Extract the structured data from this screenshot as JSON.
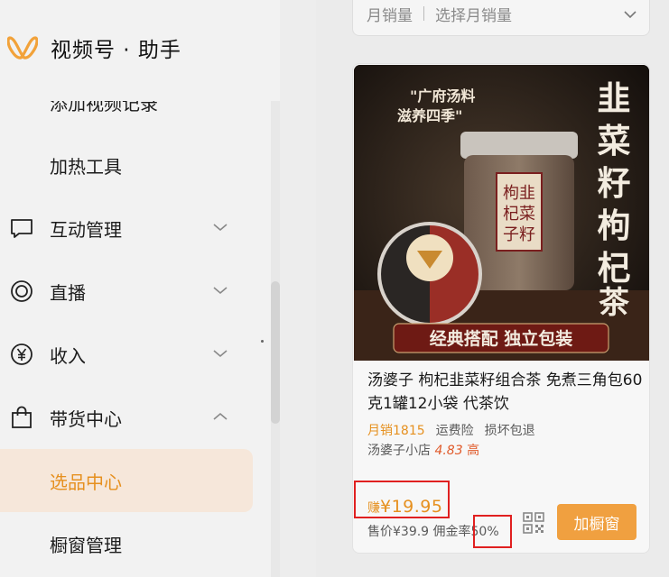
{
  "brand": {
    "title": "视频号 · 助手",
    "icon": "channels-logo-icon"
  },
  "menu": {
    "partial_label": "添加视频记录",
    "items": [
      {
        "label": "加热工具",
        "type": "sub"
      },
      {
        "label": "互动管理",
        "type": "top",
        "icon": "chat-icon",
        "chevron": "down"
      },
      {
        "label": "直播",
        "type": "top",
        "icon": "live-circle-icon",
        "chevron": "down"
      },
      {
        "label": "收入",
        "type": "top",
        "icon": "yen-icon",
        "chevron": "down"
      },
      {
        "label": "带货中心",
        "type": "top",
        "icon": "shopping-bag-icon",
        "chevron": "up"
      },
      {
        "label": "选品中心",
        "type": "sub",
        "active": true
      },
      {
        "label": "橱窗管理",
        "type": "sub"
      }
    ]
  },
  "filter": {
    "label": "月销量",
    "placeholder": "选择月销量"
  },
  "product": {
    "image_text": {
      "slogan_line1": "\"广府汤料",
      "slogan_line2": "滋养四季\"",
      "vertical_title": "韭菜籽枸杞茶",
      "jar_label": "枸韭杞菜子籽",
      "banner": "经典搭配 独立包装"
    },
    "title": "汤婆子 枸杞韭菜籽组合茶 免煮三角包60克1罐12小袋 代茶饮",
    "sales": "月销1815",
    "tag1": "运费险",
    "tag2": "损坏包退",
    "shop_name": "汤婆子小店",
    "shop_rating": "4.83",
    "shop_rating_label": "高",
    "earn_label": "赚",
    "earn_price": "¥19.95",
    "price_line": "售价¥39.9 佣金率50%",
    "add_button": "加橱窗"
  },
  "colors": {
    "accent": "#e6901f",
    "active_bg": "#f6e7da",
    "button": "#f0a040",
    "highlight": "#e02020"
  }
}
